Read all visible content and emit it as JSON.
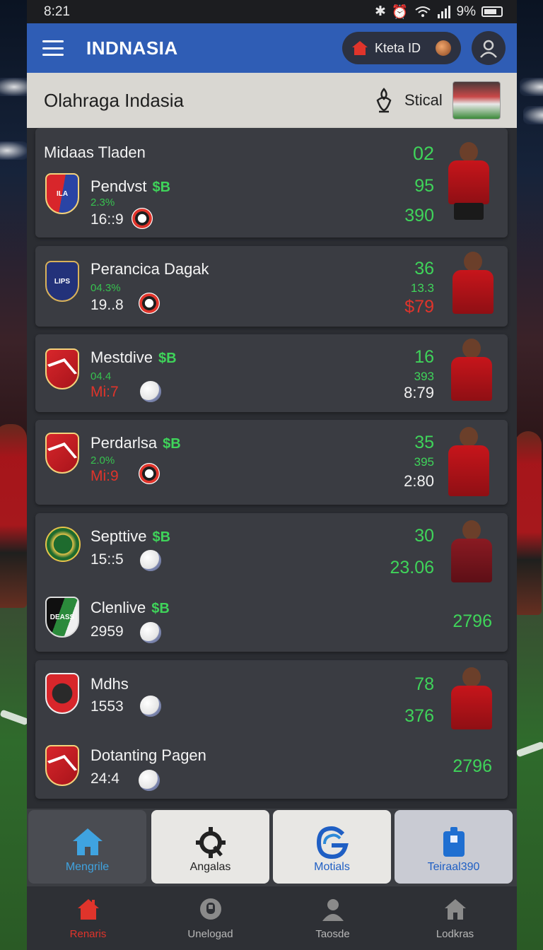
{
  "status_bar": {
    "time": "8:21",
    "battery": "9%"
  },
  "app_bar": {
    "title": "INDNASIA",
    "account_label": "Kteta ID"
  },
  "section": {
    "title": "Olahraga Indasia",
    "right_label": "Stical"
  },
  "cards": [
    {
      "heading": "Midaas Tladen",
      "teams": [
        {
          "name": "Pendvst",
          "badge": "$B",
          "pct": "2.3%",
          "info": "16::9",
          "info_color": "white"
        }
      ],
      "values": [
        "02",
        "95",
        "390"
      ],
      "value_colors": [
        "#3fd45a",
        "#3fd45a",
        "#3fd45a"
      ]
    },
    {
      "heading": "",
      "teams": [
        {
          "name": "Perancica Dagak",
          "badge": "",
          "pct": "04.3%",
          "info": "19..8",
          "info_color": "white"
        }
      ],
      "values": [
        "36",
        "13.3",
        "$79"
      ],
      "value_colors": [
        "#3fd45a",
        "#3fd45a",
        "#e0342b"
      ]
    },
    {
      "heading": "",
      "teams": [
        {
          "name": "Mestdive",
          "badge": "$B",
          "pct": "04.4",
          "info": "Mi:7",
          "info_color": "red"
        }
      ],
      "values": [
        "16",
        "393",
        "8:79"
      ],
      "value_colors": [
        "#3fd45a",
        "#3fd45a",
        "#f0f0f0"
      ]
    },
    {
      "heading": "",
      "teams": [
        {
          "name": "Perdarlsa",
          "badge": "$B",
          "pct": "2.0%",
          "info": "Mi:9",
          "info_color": "red"
        }
      ],
      "values": [
        "35",
        "395",
        "2:80"
      ],
      "value_colors": [
        "#3fd45a",
        "#3fd45a",
        "#f0f0f0"
      ]
    },
    {
      "heading": "",
      "teams": [
        {
          "name": "Septtive",
          "badge": "$B",
          "pct": "",
          "info": "15::5",
          "info_color": "white"
        },
        {
          "name": "Clenlive",
          "badge": "$B",
          "pct": "",
          "info": "2959",
          "info_color": "white"
        }
      ],
      "values": [
        "30",
        "23.06",
        "2796"
      ],
      "value_colors": [
        "#3fd45a",
        "#3fd45a",
        "#3fd45a"
      ]
    },
    {
      "heading": "",
      "teams": [
        {
          "name": "Mdhs",
          "badge": "",
          "pct": "",
          "info": "1553",
          "info_color": "white"
        },
        {
          "name": "Dotanting Pagen",
          "badge": "",
          "pct": "",
          "info": "24:4",
          "info_color": "white"
        }
      ],
      "values": [
        "78",
        "376",
        "2796"
      ],
      "value_colors": [
        "#3fd45a",
        "#3fd45a",
        "#3fd45a"
      ]
    }
  ],
  "tiles": [
    {
      "label": "Mengrile",
      "icon": "home-icon",
      "bg": "#4a4c52",
      "fg": "#3fa3e0"
    },
    {
      "label": "Angalas",
      "icon": "gear-icon",
      "bg": "#e8e7e4",
      "fg": "#222222"
    },
    {
      "label": "Motials",
      "icon": "g-logo-icon",
      "bg": "#e8e7e4",
      "fg": "#1f5fc4"
    },
    {
      "label": "Teiraal390",
      "icon": "box-icon",
      "bg": "#c9cbd3",
      "fg": "#1f5fc4"
    }
  ],
  "nav": [
    {
      "label": "Renaris",
      "icon": "home-icon",
      "active": true
    },
    {
      "label": "Unelogad",
      "icon": "badge-icon",
      "active": false
    },
    {
      "label": "Taosde",
      "icon": "person-icon",
      "active": false
    },
    {
      "label": "Lodkras",
      "icon": "house-icon",
      "active": false
    }
  ],
  "colors": {
    "accent": "#2f5db5",
    "positive": "#3fd45a",
    "negative": "#e0342b"
  }
}
